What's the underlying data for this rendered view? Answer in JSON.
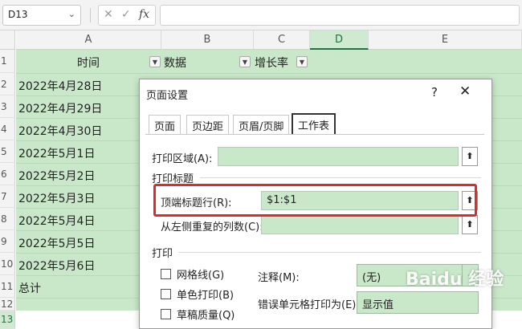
{
  "formula_bar": {
    "name_box": "D13",
    "cancel_icon": "✕",
    "enter_icon": "✓",
    "fx_label": "fx",
    "formula": ""
  },
  "columns": [
    "A",
    "B",
    "C",
    "D",
    "E"
  ],
  "rows": [
    "1",
    "2",
    "3",
    "4",
    "5",
    "6",
    "7",
    "8",
    "9",
    "10",
    "11",
    "12",
    "13"
  ],
  "header_row": {
    "a": "时间",
    "b": "数据",
    "c": "增长率"
  },
  "dates": [
    "2022年4月28日",
    "2022年4月29日",
    "2022年4月30日",
    "2022年5月1日",
    "2022年5月2日",
    "2022年5月3日",
    "2022年5月4日",
    "2022年5月5日",
    "2022年5月6日"
  ],
  "total_label": "总计",
  "selected_cell": "D13",
  "colors": {
    "accent": "#217346",
    "fill_green": "#c9e8c9",
    "highlight": "#e02a2a"
  },
  "dialog": {
    "title": "页面设置",
    "help": "?",
    "close": "✕",
    "tabs": [
      "页面",
      "页边距",
      "页眉/页脚",
      "工作表"
    ],
    "active_tab": "工作表",
    "print_area_label": "打印区域(A):",
    "print_area_value": "",
    "print_titles_section": "打印标题",
    "top_rows_label": "顶端标题行(R):",
    "top_rows_value": "$1:$1",
    "left_cols_label": "从左侧重复的列数(C):",
    "left_cols_value": "",
    "print_section": "打印",
    "checkboxes": [
      "网格线(G)",
      "单色打印(B)",
      "草稿质量(Q)"
    ],
    "comments_label": "注释(M):",
    "comments_value": "(无)",
    "errors_label": "错误单元格打印为(E):",
    "errors_value": "显示值"
  },
  "watermark": "Baidu 经验"
}
